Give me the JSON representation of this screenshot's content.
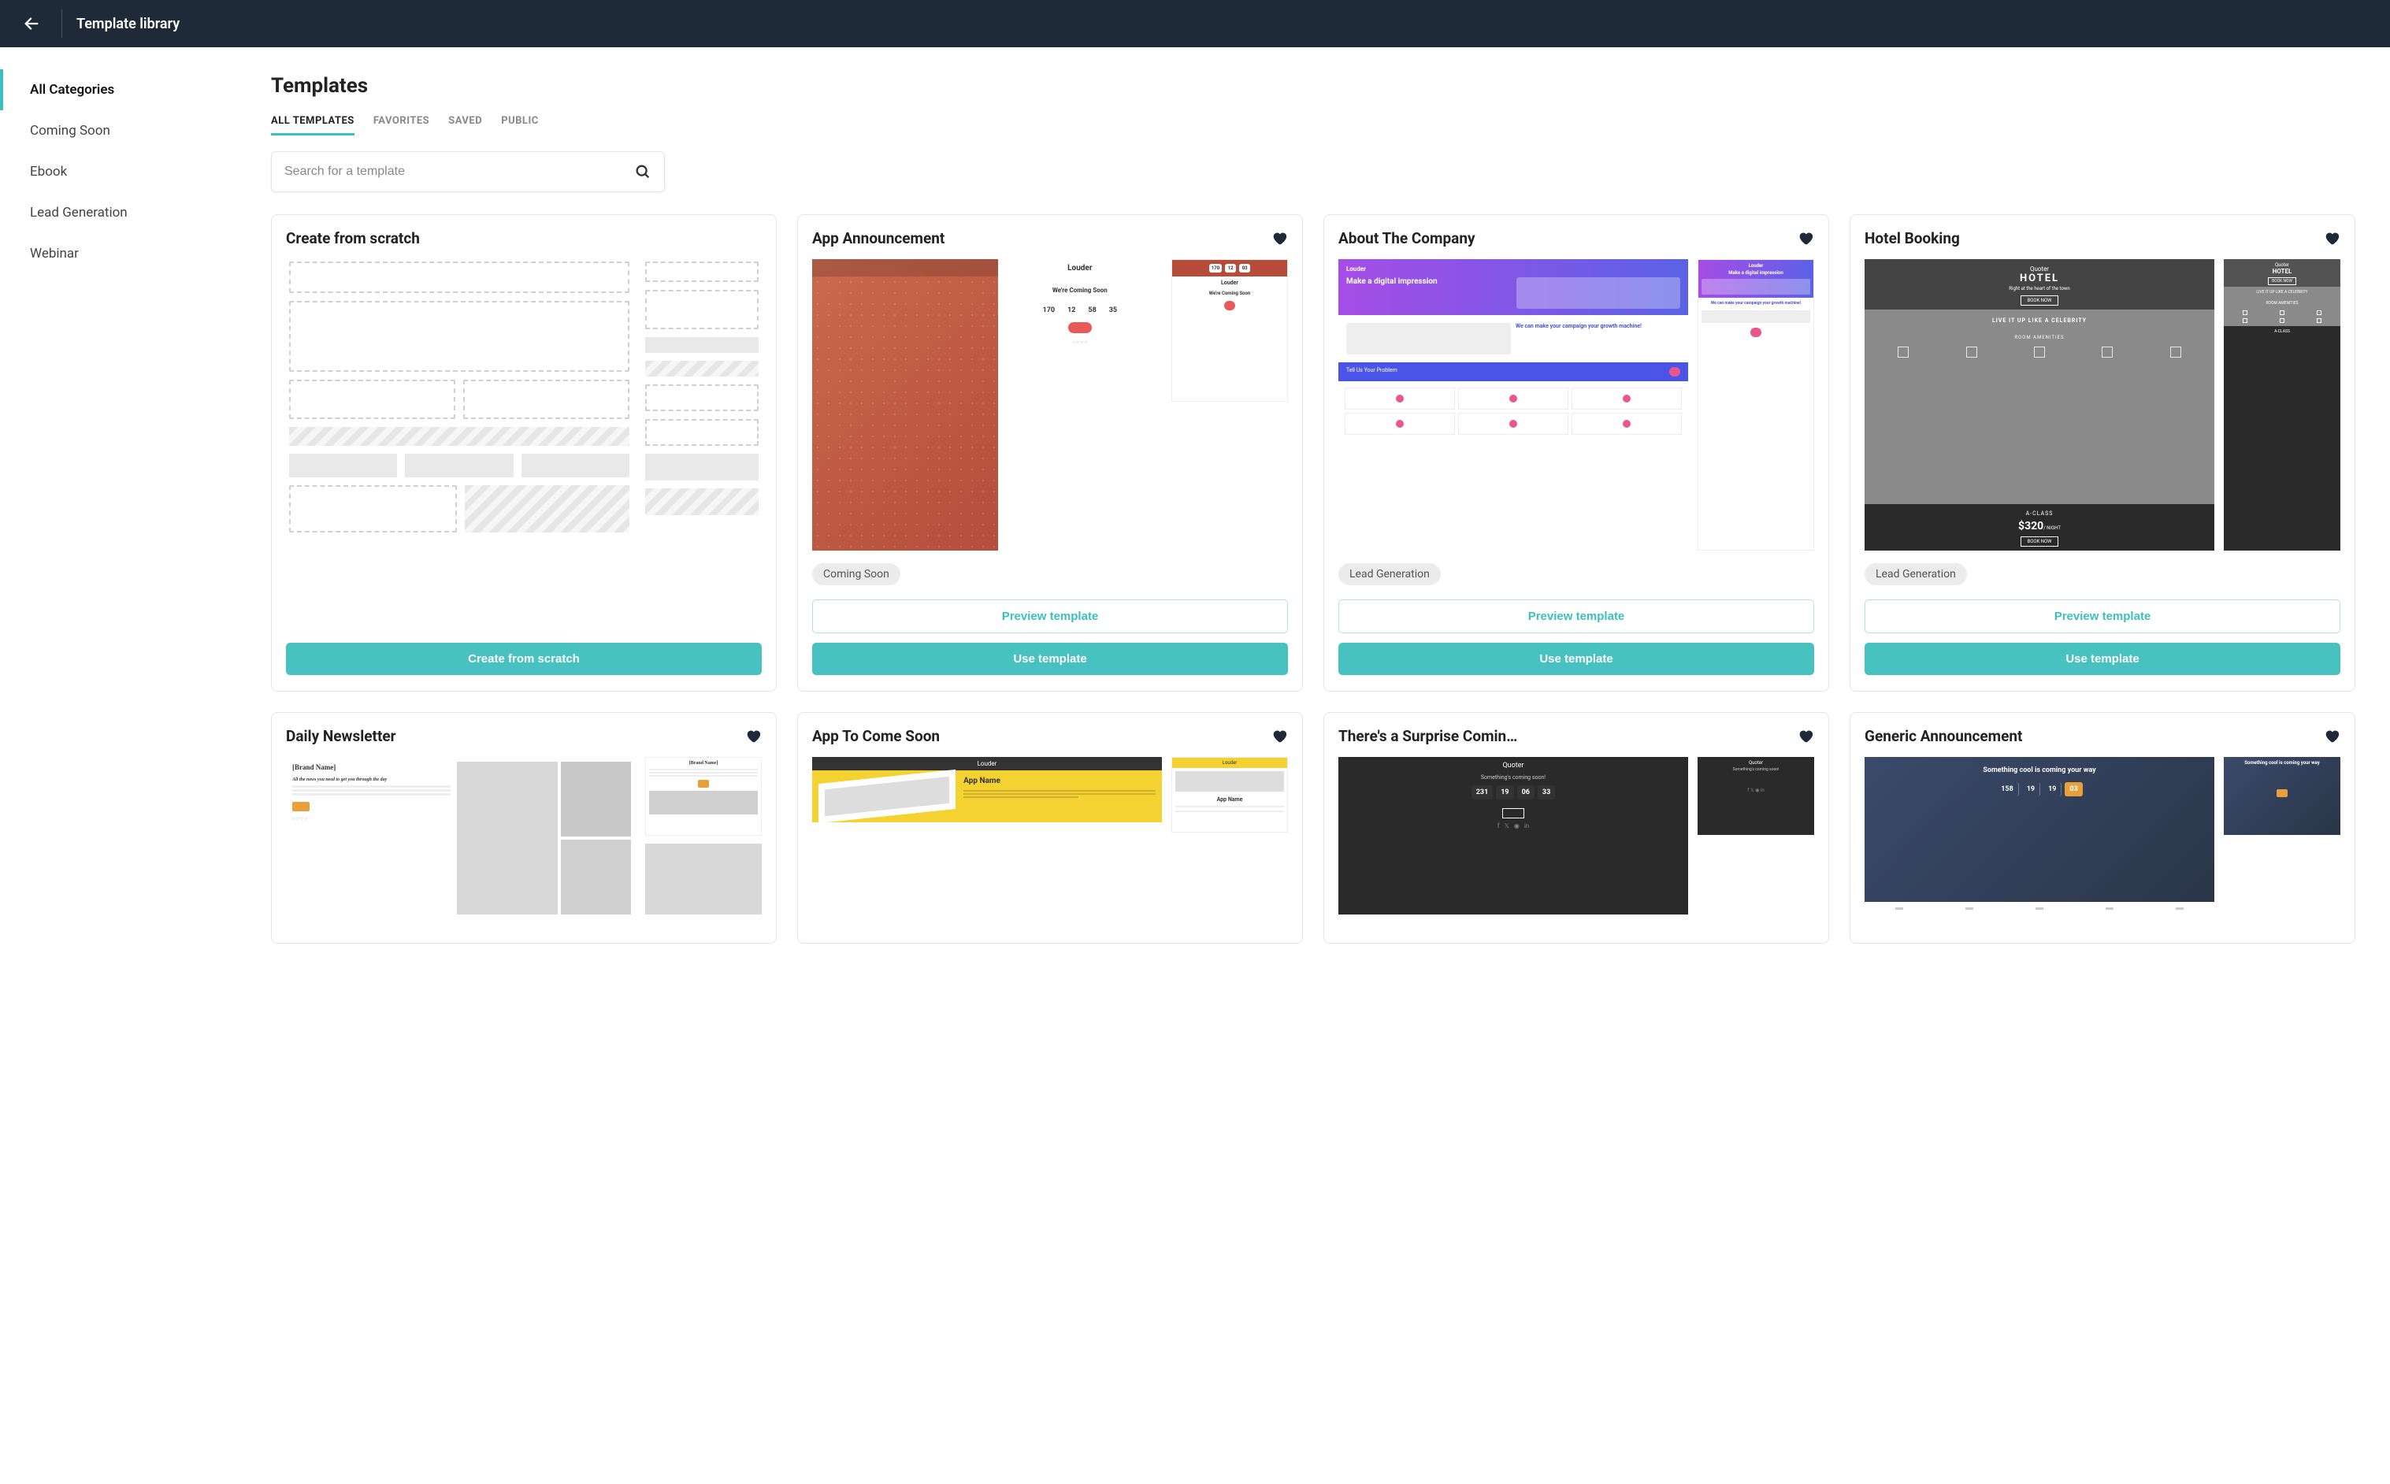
{
  "header": {
    "title": "Template library"
  },
  "sidebar": {
    "items": [
      {
        "label": "All Categories",
        "active": true
      },
      {
        "label": "Coming Soon"
      },
      {
        "label": "Ebook"
      },
      {
        "label": "Lead Generation"
      },
      {
        "label": "Webinar"
      }
    ]
  },
  "main": {
    "title": "Templates",
    "tabs": [
      {
        "label": "ALL TEMPLATES",
        "active": true
      },
      {
        "label": "FAVORITES"
      },
      {
        "label": "SAVED"
      },
      {
        "label": "PUBLIC"
      }
    ],
    "search": {
      "placeholder": "Search for a template",
      "value": ""
    },
    "preview_label": "Preview template",
    "use_label": "Use template",
    "scratch_label": "Create from scratch"
  },
  "cards": [
    {
      "title": "Create from scratch",
      "scratch": true
    },
    {
      "title": "App Announcement",
      "tag": "Coming Soon",
      "thumb": "app-announcement"
    },
    {
      "title": "About The Company",
      "tag": "Lead Generation",
      "thumb": "about-company"
    },
    {
      "title": "Hotel Booking",
      "tag": "Lead Generation",
      "thumb": "hotel-booking"
    },
    {
      "title": "Daily Newsletter",
      "thumb": "daily-newsletter",
      "short": true
    },
    {
      "title": "App To Come Soon",
      "thumb": "app-to-come",
      "short": true
    },
    {
      "title": "There's a Surprise Comin…",
      "thumb": "surprise",
      "short": true
    },
    {
      "title": "Generic Announcement",
      "thumb": "generic-announcement",
      "short": true
    }
  ],
  "thumb_text": {
    "louder": "Louder",
    "coming_soon": "We're Coming Soon",
    "digital_impression": "Make a digital impression",
    "campaign_growth": "We can make your campaign your growth machine!",
    "tell_problem": "Tell Us Your Problem",
    "quoter": "Quoter",
    "hotel": "HOTEL",
    "hotel_tag": "Right at the heart of the town",
    "celebrity": "LIVE IT UP LIKE A CELEBRITY",
    "amenities": "ROOM AMENITIES",
    "aclass": "A-CLASS",
    "price": "$320",
    "per_night": "/ NIGHT",
    "book_now": "BOOK NOW",
    "brand_name": "[Brand Name]",
    "newsletter_sub": "All the news you need to get you through the day",
    "app_name": "App Name",
    "something_cool": "Something cool is coming your way",
    "something_coming": "Something's coming soon!",
    "countdown1": [
      "170",
      "12",
      "58",
      "35"
    ],
    "countdown2": [
      "170",
      "12",
      "03"
    ],
    "countdown3": [
      "231",
      "19",
      "06",
      "33"
    ],
    "countdown4": [
      "158",
      "19",
      "19",
      "03"
    ]
  }
}
